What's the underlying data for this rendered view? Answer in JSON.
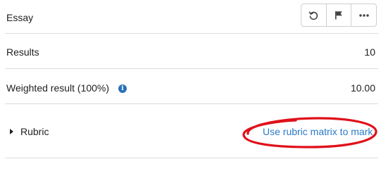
{
  "header": {
    "title": "Essay",
    "toolbar": {
      "reset_icon": "undo-icon",
      "flag_icon": "flag-icon",
      "more_icon": "more-options-icon"
    }
  },
  "results": {
    "label": "Results",
    "value": "10"
  },
  "weighted": {
    "label": "Weighted result (100%)",
    "info_icon": "info-icon",
    "info_glyph": "i",
    "value": "10.00"
  },
  "rubric": {
    "label": "Rubric",
    "link": "Use rubric matrix to mark"
  },
  "colors": {
    "link": "#2a7ac5",
    "info": "#2b71b8",
    "annotation": "#e0101a",
    "divider": "#dcdcdc"
  }
}
